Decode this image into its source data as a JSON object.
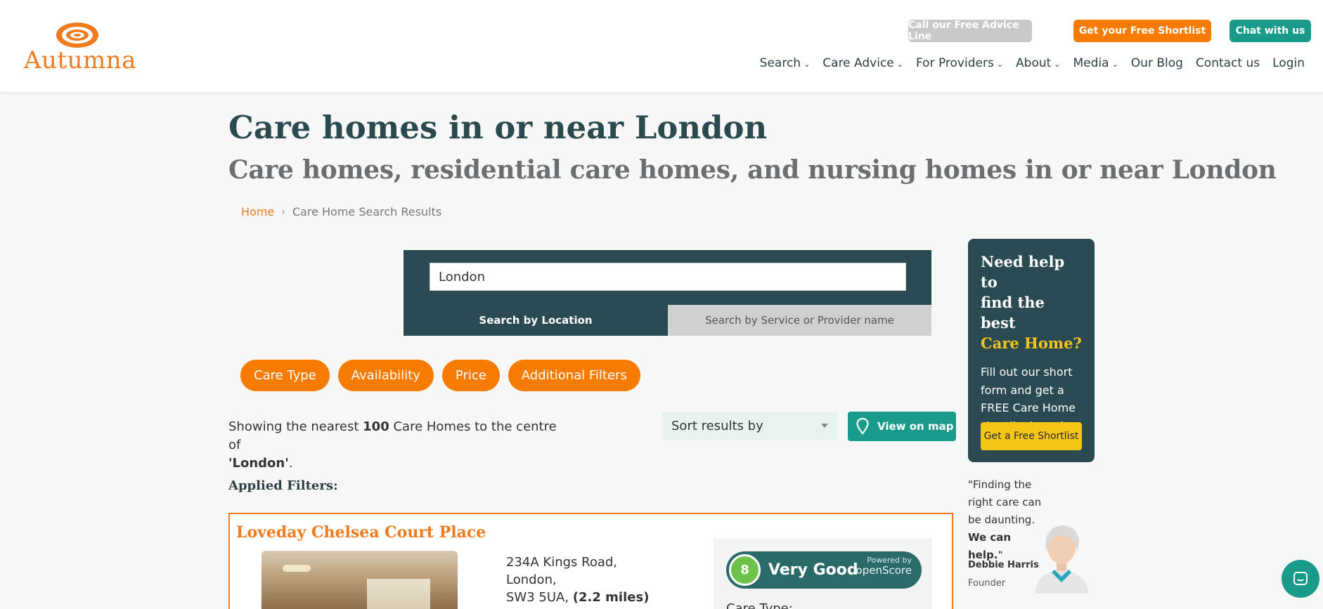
{
  "brand": {
    "name": "Autumna",
    "accent": "#f07a1c",
    "teal": "#1a9a8a",
    "dark": "#2a4a52"
  },
  "header": {
    "advice_line": "Call our Free Advice Line",
    "get_shortlist": "Get your Free Shortlist",
    "chat": "Chat with us",
    "nav": [
      "Search",
      "Care Advice",
      "For Providers",
      "About",
      "Media",
      "Our Blog",
      "Contact us",
      "Login"
    ]
  },
  "page": {
    "title": "Care homes in or near London",
    "subtitle": "Care homes, residential care homes, and nursing homes in or near London"
  },
  "breadcrumb": {
    "home": "Home",
    "current": "Care Home Search Results"
  },
  "search": {
    "value": "London",
    "tab_location": "Search by Location",
    "tab_service": "Search by Service or Provider name"
  },
  "filters": [
    "Care Type",
    "Availability",
    "Price",
    "Additional Filters"
  ],
  "results": {
    "showing_prefix": "Showing the nearest",
    "count": "100",
    "showing_mid": "Care Homes to the centre of",
    "location": "'London'",
    "showing_suffix": ".",
    "sort_label": "Sort results by",
    "map_button": "View on map",
    "applied_filters": "Applied Filters:"
  },
  "card": {
    "name": "Loveday Chelsea Court Place",
    "address_line1": "234A Kings Road,",
    "address_line2": "London,",
    "address_line3": "SW3 5UA,",
    "distance": "(2.2 miles)",
    "score": "8",
    "score_label": "Very Good",
    "powered_by": "Powered by",
    "score_brand": "openScore",
    "care_type_label": "Care Type:"
  },
  "sidebar": {
    "title_line1": "Need help to",
    "title_line2": "find the best",
    "title_highlight": "Care Home?",
    "body": "Fill out our short form and get a FREE Care Home shortlist based on your needs.",
    "button": "Get a Free Shortlist",
    "quote_part1": "\"Finding the right care can be daunting.",
    "quote_bold": "We can help.",
    "quote_end": "\"",
    "person_name": "Debbie Harris",
    "person_role": "Founder"
  }
}
